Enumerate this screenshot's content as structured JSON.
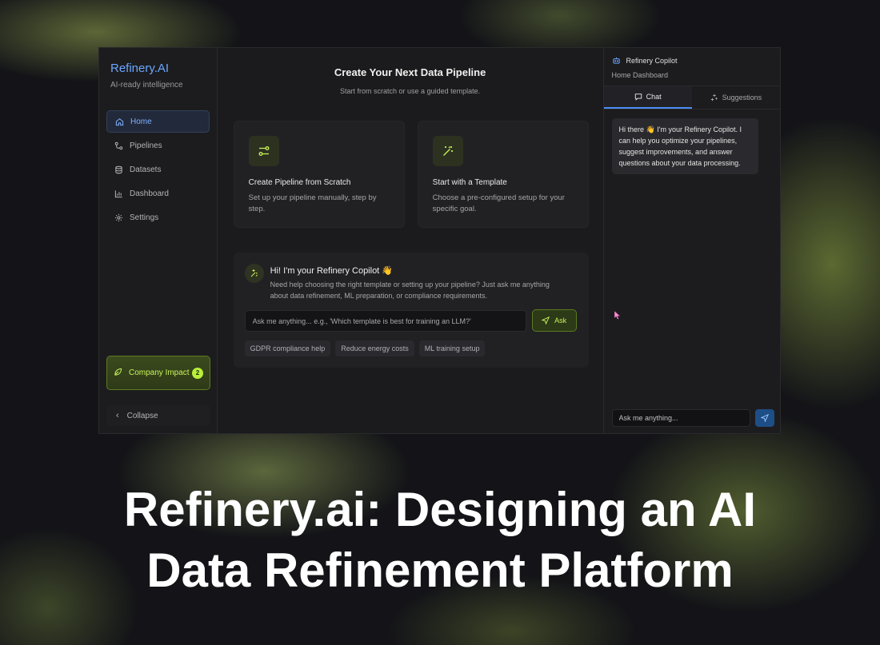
{
  "brand": {
    "name": "Refinery.AI",
    "tagline": "AI-ready intelligence"
  },
  "sidebar": {
    "items": [
      {
        "label": "Home",
        "icon": "home-icon",
        "active": true
      },
      {
        "label": "Pipelines",
        "icon": "pipeline-icon"
      },
      {
        "label": "Datasets",
        "icon": "database-icon"
      },
      {
        "label": "Dashboard",
        "icon": "chart-icon"
      },
      {
        "label": "Settings",
        "icon": "gear-icon"
      }
    ],
    "impact": {
      "label": "Company Impact",
      "count": "2",
      "icon": "leaf-icon"
    },
    "collapse_label": "Collapse"
  },
  "main": {
    "title": "Create Your Next Data Pipeline",
    "subtitle": "Start from scratch or use a guided template.",
    "cards": [
      {
        "title": "Create Pipeline from Scratch",
        "desc": "Set up your pipeline manually, step by step.",
        "icon": "route-icon"
      },
      {
        "title": "Start with a Template",
        "desc": "Choose a pre-configured setup for your specific goal.",
        "icon": "magic-wand-icon"
      }
    ],
    "copilot": {
      "title": "Hi! I'm your Refinery Copilot 👋",
      "desc": "Need help choosing the right template or setting up your pipeline? Just ask me anything about data refinement, ML preparation, or compliance requirements.",
      "placeholder": "Ask me anything... e.g., 'Which template is best for training an LLM?'",
      "ask_label": "Ask",
      "chips": [
        "GDPR compliance help",
        "Reduce energy costs",
        "ML training setup"
      ]
    }
  },
  "panel": {
    "title": "Refinery Copilot",
    "subtitle": "Home Dashboard",
    "tabs": [
      {
        "label": "Chat",
        "active": true
      },
      {
        "label": "Suggestions"
      }
    ],
    "message": "Hi there 👋 I'm your Refinery Copilot. I can help you optimize your pipelines, suggest improvements, and answer questions about your data processing.",
    "input_placeholder": "Ask me anything..."
  },
  "caption": {
    "line1": "Refinery.ai: Designing an AI",
    "line2": "Data Refinement Platform"
  },
  "colors": {
    "accent_blue": "#6aa6ff",
    "accent_lime": "#c9f25a",
    "send_blue": "#1e4e86"
  }
}
